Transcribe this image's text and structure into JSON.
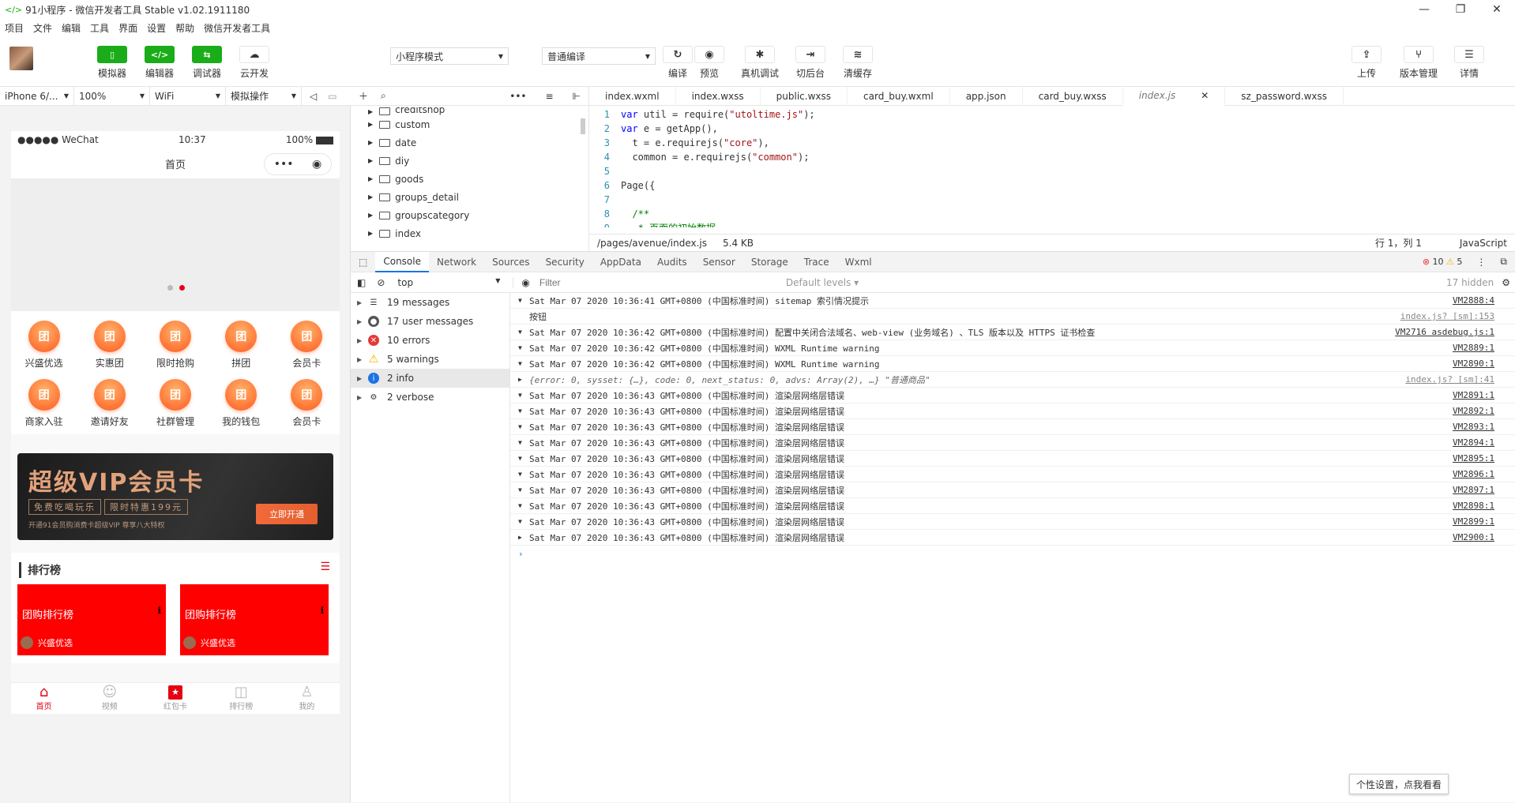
{
  "window": {
    "title": "91小程序 - 微信开发者工具 Stable v1.02.1911180",
    "controls": [
      "—",
      "❐",
      "✕"
    ]
  },
  "menu": [
    "项目",
    "文件",
    "编辑",
    "工具",
    "界面",
    "设置",
    "帮助",
    "微信开发者工具"
  ],
  "toolbar": {
    "simulator": "模拟器",
    "editor": "编辑器",
    "debugger": "调试器",
    "cloud": "云开发",
    "mode": "小程序模式",
    "compile_mode": "普通编译",
    "compile": "编译",
    "preview": "预览",
    "remote_debug": "真机调试",
    "background": "切后台",
    "clear_cache": "清缓存",
    "upload": "上传",
    "version": "版本管理",
    "details": "详情"
  },
  "subtoolbar": {
    "device": "iPhone 6/...",
    "zoom": "100%",
    "network": "WiFi",
    "operation": "模拟操作"
  },
  "phone": {
    "carrier": "●●●●● WeChat",
    "time": "10:37",
    "battery": "100%",
    "nav_title": "首页",
    "grid": [
      "兴盛优选",
      "实惠团",
      "限时抢购",
      "拼团",
      "会员卡",
      "商家入驻",
      "邀请好友",
      "社群管理",
      "我的钱包",
      "会员卡"
    ],
    "grid_icon": "团",
    "vip": {
      "title": "超级VIP会员卡",
      "tag1": "免费吃喝玩乐",
      "tag2": "限时特惠199元",
      "sub": "开通91会员购消费卡超级VIP 尊享八大特权",
      "button": "立即开通"
    },
    "rank": {
      "title": "排行榜",
      "card1": "团购排行榜",
      "card2": "团购排行榜",
      "shop": "兴盛优选"
    },
    "tabs": [
      "首页",
      "视频",
      "红包卡",
      "排行榜",
      "我的"
    ]
  },
  "filetree": [
    "creditshop",
    "custom",
    "date",
    "diy",
    "goods",
    "groups_detail",
    "groupscategory",
    "index"
  ],
  "editor": {
    "tabs": [
      "index.wxml",
      "index.wxss",
      "public.wxss",
      "card_buy.wxml",
      "app.json",
      "card_buy.wxss",
      "index.js",
      "sz_password.wxss"
    ],
    "active_tab": "index.js",
    "path": "/pages/avenue/index.js",
    "size": "5.4 KB",
    "cursor": "行 1，列 1",
    "lang": "JavaScript",
    "line_numbers": [
      "1",
      "2",
      "3",
      "4",
      "5",
      "6",
      "7",
      "8",
      "9"
    ]
  },
  "devtools": {
    "tabs": [
      "Console",
      "Network",
      "Sources",
      "Security",
      "AppData",
      "Audits",
      "Sensor",
      "Storage",
      "Trace",
      "Wxml"
    ],
    "errors": "10",
    "warnings": "5",
    "context": "top",
    "filter_placeholder": "Filter",
    "levels": "Default levels",
    "hidden": "17 hidden",
    "sidebar": [
      "19 messages",
      "17 user messages",
      "10 errors",
      "5 warnings",
      "2 info",
      "2 verbose"
    ],
    "logs": [
      {
        "arrow": "▼",
        "text": "Sat Mar 07 2020 10:36:41 GMT+0800 (中国标准时间) sitemap 索引情况提示",
        "src": "VM2888:4"
      },
      {
        "arrow": "",
        "text": "按钮",
        "src": "index.js? [sm]:153",
        "gray": true
      },
      {
        "arrow": "▼",
        "text": "Sat Mar 07 2020 10:36:42 GMT+0800 (中国标准时间) 配置中关闭合法域名、web-view (业务域名) 、TLS 版本以及 HTTPS 证书检查",
        "src": "VM2716 asdebug.js:1"
      },
      {
        "arrow": "▼",
        "text": "Sat Mar 07 2020 10:36:42 GMT+0800 (中国标准时间) WXML Runtime warning",
        "src": "VM2889:1"
      },
      {
        "arrow": "▼",
        "text": "Sat Mar 07 2020 10:36:42 GMT+0800 (中国标准时间) WXML Runtime warning",
        "src": "VM2890:1"
      },
      {
        "arrow": "▶",
        "text": "{error: 0, sysset: {…}, code: 0, next_status: 0, advs: Array(2), …} \"普通商品\"",
        "src": "index.js? [sm]:41",
        "gray": true,
        "obj": true
      },
      {
        "arrow": "▼",
        "text": "Sat Mar 07 2020 10:36:43 GMT+0800 (中国标准时间) 渲染层网络层错误",
        "src": "VM2891:1"
      },
      {
        "arrow": "▼",
        "text": "Sat Mar 07 2020 10:36:43 GMT+0800 (中国标准时间) 渲染层网络层错误",
        "src": "VM2892:1"
      },
      {
        "arrow": "▼",
        "text": "Sat Mar 07 2020 10:36:43 GMT+0800 (中国标准时间) 渲染层网络层错误",
        "src": "VM2893:1"
      },
      {
        "arrow": "▼",
        "text": "Sat Mar 07 2020 10:36:43 GMT+0800 (中国标准时间) 渲染层网络层错误",
        "src": "VM2894:1"
      },
      {
        "arrow": "▼",
        "text": "Sat Mar 07 2020 10:36:43 GMT+0800 (中国标准时间) 渲染层网络层错误",
        "src": "VM2895:1"
      },
      {
        "arrow": "▼",
        "text": "Sat Mar 07 2020 10:36:43 GMT+0800 (中国标准时间) 渲染层网络层错误",
        "src": "VM2896:1"
      },
      {
        "arrow": "▼",
        "text": "Sat Mar 07 2020 10:36:43 GMT+0800 (中国标准时间) 渲染层网络层错误",
        "src": "VM2897:1"
      },
      {
        "arrow": "▼",
        "text": "Sat Mar 07 2020 10:36:43 GMT+0800 (中国标准时间) 渲染层网络层错误",
        "src": "VM2898:1"
      },
      {
        "arrow": "▼",
        "text": "Sat Mar 07 2020 10:36:43 GMT+0800 (中国标准时间) 渲染层网络层错误",
        "src": "VM2899:1"
      },
      {
        "arrow": "▶",
        "text": "Sat Mar 07 2020 10:36:43 GMT+0800 (中国标准时间) 渲染层网络层错误",
        "src": "VM2900:1"
      }
    ]
  },
  "tooltip": "个性设置，点我看看",
  "colors": {
    "green": "#1aad19",
    "red": "#e60012",
    "orange": "#ff5a1f"
  }
}
